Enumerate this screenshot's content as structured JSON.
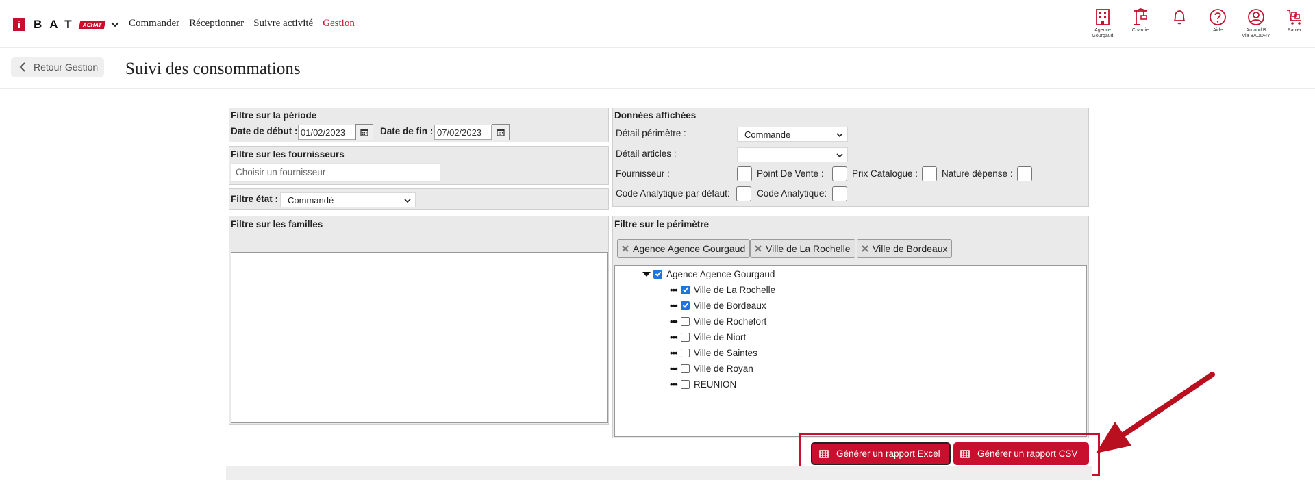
{
  "brand": {
    "logo_i": "i",
    "logo_text": "BAT",
    "logo_tag": "ACHAT",
    "color": "#c8102e"
  },
  "nav": [
    {
      "label": "Commander",
      "active": false
    },
    {
      "label": "Réceptionner",
      "active": false
    },
    {
      "label": "Suivre activité",
      "active": false
    },
    {
      "label": "Gestion",
      "active": true
    }
  ],
  "header_icons": [
    {
      "icon": "building-icon",
      "label_1": "Agence",
      "label_2": "Gourgaud"
    },
    {
      "icon": "crane-icon",
      "label_1": "Chantier",
      "label_2": ""
    },
    {
      "icon": "bell-icon",
      "label_1": "",
      "label_2": ""
    },
    {
      "icon": "help-icon",
      "label_1": "Aide",
      "label_2": ""
    },
    {
      "icon": "user-icon",
      "label_1": "Arnaud B",
      "label_2": "Via BAUDRY"
    },
    {
      "icon": "cart-icon",
      "label_1": "Panier",
      "label_2": ""
    }
  ],
  "back_label": "Retour Gestion",
  "page_title": "Suivi des consommations",
  "period": {
    "title": "Filtre sur la période",
    "start_label": "Date de début :",
    "start_value": "01/02/2023",
    "end_label": "Date de fin :",
    "end_value": "07/02/2023"
  },
  "suppliers": {
    "title": "Filtre sur les fournisseurs",
    "placeholder": "Choisir un fournisseur"
  },
  "state": {
    "label": "Filtre état :",
    "value": "Commandé"
  },
  "families": {
    "title": "Filtre sur les familles"
  },
  "display": {
    "title": "Données affichées",
    "perimeter_label": "Détail périmètre :",
    "perimeter_value": "Commande",
    "articles_label": "Détail articles :",
    "articles_value": "",
    "supplier_label": "Fournisseur :",
    "pos_label": "Point De Vente :",
    "catalog_label": "Prix Catalogue :",
    "nature_label": "Nature dépense :",
    "analytic_default_label": "Code Analytique par défaut:",
    "analytic_label": "Code Analytique:"
  },
  "perimeter": {
    "title": "Filtre sur le périmètre",
    "chips": [
      "Agence Agence Gourgaud",
      "Ville de La Rochelle",
      "Ville de Bordeaux"
    ],
    "root": {
      "label": "Agence Agence Gourgaud",
      "checked": true
    },
    "children": [
      {
        "label": "Ville de La Rochelle",
        "checked": true
      },
      {
        "label": "Ville de Bordeaux",
        "checked": true
      },
      {
        "label": "Ville de Rochefort",
        "checked": false
      },
      {
        "label": "Ville de Niort",
        "checked": false
      },
      {
        "label": "Ville de Saintes",
        "checked": false
      },
      {
        "label": "Ville de Royan",
        "checked": false
      },
      {
        "label": "REUNION",
        "checked": false
      }
    ]
  },
  "actions": {
    "excel": "Générer un rapport Excel",
    "csv": "Générer un rapport CSV"
  },
  "tree_dots": "•••"
}
